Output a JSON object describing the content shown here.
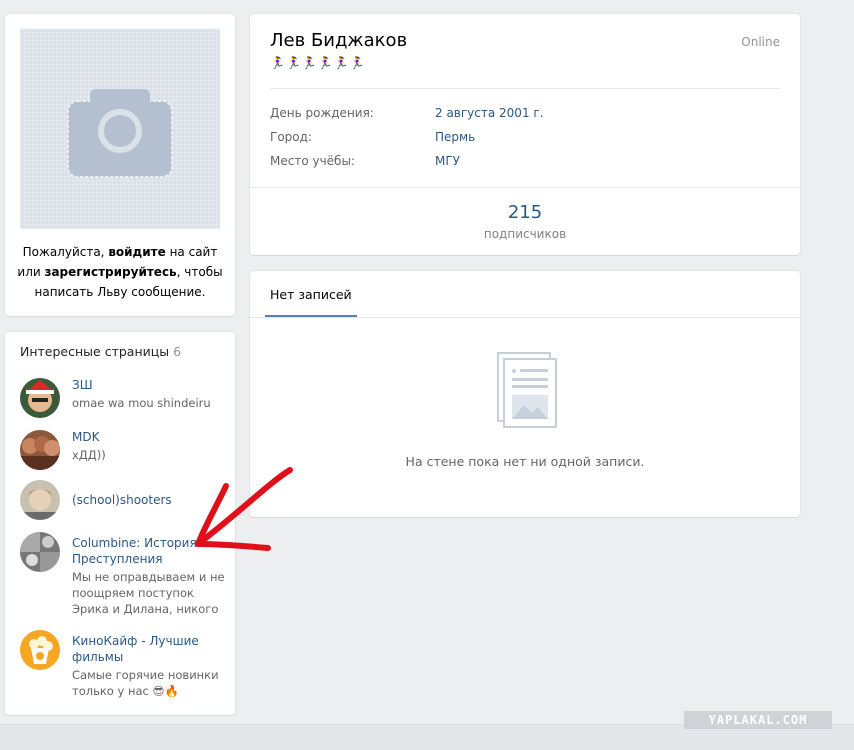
{
  "profile": {
    "name": "Лев Биджаков",
    "status": "Online",
    "emoji_row": "🏃‍♀️🏃‍♀️🏃‍♀️🏃‍♀️🏃‍♀️🏃‍♀️",
    "info": [
      {
        "label": "День рождения:",
        "value": "2 августа 2001 г."
      },
      {
        "label": "Город:",
        "value": "Пермь"
      },
      {
        "label": "Место учёбы:",
        "value": "МГУ"
      }
    ],
    "followers_count": "215",
    "followers_label": "подписчиков"
  },
  "login_prompt": {
    "part1": "Пожалуйста, ",
    "login_link": "войдите",
    "part2": " на сайт или ",
    "register_link": "зарегистрируйтесь",
    "part3": ", чтобы написать Льву сообщение."
  },
  "pages": {
    "title": "Интересные страницы",
    "count": "6",
    "items": [
      {
        "name": "ЗШ",
        "desc": "omae wa mou shindeiru"
      },
      {
        "name": "MDK",
        "desc": "xДД))"
      },
      {
        "name": "(school)shooters",
        "desc": ""
      },
      {
        "name": "Columbine: История Преступления",
        "desc": "Мы не оправдываем и не поощряем поступок Эрика и Дилана, никого"
      },
      {
        "name": "КиноКайф - Лучшие фильмы",
        "desc": "Самые горячие новинки только у нас 😎🔥"
      }
    ]
  },
  "wall": {
    "tab_label": "Нет записей",
    "empty_text": "На стене пока нет ни одной записи."
  },
  "watermark": "YAPLAKAL.COM",
  "colors": {
    "background": "#edeef0",
    "link": "#2a5885",
    "tab_underline": "#5181b8",
    "arrow": "#e0101a"
  }
}
